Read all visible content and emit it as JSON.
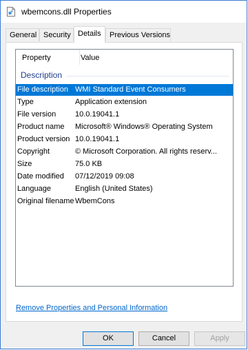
{
  "window": {
    "title": "wbemcons.dll Properties"
  },
  "tabs": [
    {
      "label": "General"
    },
    {
      "label": "Security"
    },
    {
      "label": "Details"
    },
    {
      "label": "Previous Versions"
    }
  ],
  "list": {
    "header_property": "Property",
    "header_value": "Value",
    "group_label": "Description",
    "rows": [
      {
        "property": "File description",
        "value": "WMI Standard Event Consumers"
      },
      {
        "property": "Type",
        "value": "Application extension"
      },
      {
        "property": "File version",
        "value": "10.0.19041.1"
      },
      {
        "property": "Product name",
        "value": "Microsoft® Windows® Operating System"
      },
      {
        "property": "Product version",
        "value": "10.0.19041.1"
      },
      {
        "property": "Copyright",
        "value": "© Microsoft Corporation. All rights reserv..."
      },
      {
        "property": "Size",
        "value": "75.0 KB"
      },
      {
        "property": "Date modified",
        "value": "07/12/2019 09:08"
      },
      {
        "property": "Language",
        "value": "English (United States)"
      },
      {
        "property": "Original filename",
        "value": "WbemCons"
      }
    ]
  },
  "link": {
    "label": "Remove Properties and Personal Information"
  },
  "buttons": {
    "ok": "OK",
    "cancel": "Cancel",
    "apply": "Apply"
  },
  "colors": {
    "selection": "#0078d7",
    "link": "#0066cc",
    "group": "#1e3e8b"
  }
}
